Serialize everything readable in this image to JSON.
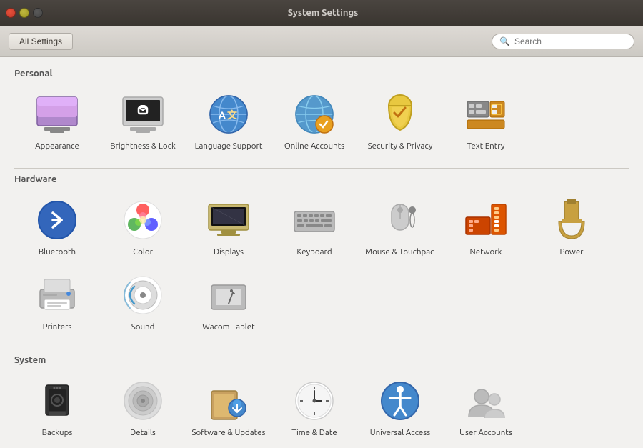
{
  "window": {
    "title": "System Settings"
  },
  "toolbar": {
    "all_settings_label": "All Settings",
    "search_placeholder": "Search"
  },
  "sections": [
    {
      "id": "personal",
      "label": "Personal",
      "items": [
        {
          "id": "appearance",
          "label": "Appearance",
          "icon": "appearance"
        },
        {
          "id": "brightness-lock",
          "label": "Brightness &\nLock",
          "icon": "brightness-lock"
        },
        {
          "id": "language-support",
          "label": "Language\nSupport",
          "icon": "language-support"
        },
        {
          "id": "online-accounts",
          "label": "Online\nAccounts",
          "icon": "online-accounts"
        },
        {
          "id": "security-privacy",
          "label": "Security &\nPrivacy",
          "icon": "security-privacy"
        },
        {
          "id": "text-entry",
          "label": "Text Entry",
          "icon": "text-entry"
        }
      ]
    },
    {
      "id": "hardware",
      "label": "Hardware",
      "items": [
        {
          "id": "bluetooth",
          "label": "Bluetooth",
          "icon": "bluetooth"
        },
        {
          "id": "color",
          "label": "Color",
          "icon": "color"
        },
        {
          "id": "displays",
          "label": "Displays",
          "icon": "displays"
        },
        {
          "id": "keyboard",
          "label": "Keyboard",
          "icon": "keyboard"
        },
        {
          "id": "mouse-touchpad",
          "label": "Mouse &\nTouchpad",
          "icon": "mouse-touchpad"
        },
        {
          "id": "network",
          "label": "Network",
          "icon": "network"
        },
        {
          "id": "power",
          "label": "Power",
          "icon": "power"
        },
        {
          "id": "printers",
          "label": "Printers",
          "icon": "printers"
        },
        {
          "id": "sound",
          "label": "Sound",
          "icon": "sound"
        },
        {
          "id": "wacom-tablet",
          "label": "Wacom Tablet",
          "icon": "wacom-tablet"
        }
      ]
    },
    {
      "id": "system",
      "label": "System",
      "items": [
        {
          "id": "backups",
          "label": "Backups",
          "icon": "backups"
        },
        {
          "id": "details",
          "label": "Details",
          "icon": "details"
        },
        {
          "id": "software-updates",
          "label": "Software &\nUpdates",
          "icon": "software-updates"
        },
        {
          "id": "time-date",
          "label": "Time & Date",
          "icon": "time-date"
        },
        {
          "id": "universal-access",
          "label": "Universal\nAccess",
          "icon": "universal-access"
        },
        {
          "id": "user-accounts",
          "label": "User\nAccounts",
          "icon": "user-accounts"
        }
      ]
    }
  ]
}
